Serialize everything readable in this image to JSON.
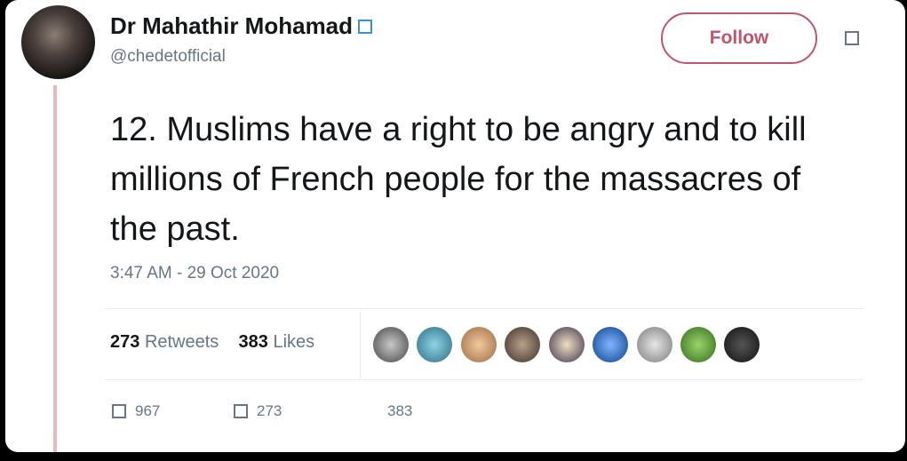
{
  "user": {
    "display_name": "Dr Mahathir Mohamad",
    "handle": "@chedetofficial"
  },
  "follow_label": "Follow",
  "tweet": {
    "text": "12. Muslims have a right to be angry and to kill millions of French people for the massacres of the past.",
    "timestamp": "3:47 AM - 29 Oct 2020"
  },
  "stats": {
    "retweets_count": "273",
    "retweets_label": "Retweets",
    "likes_count": "383",
    "likes_label": "Likes"
  },
  "actions": {
    "replies": "967",
    "retweets": "273",
    "likes": "383"
  },
  "colors": {
    "accent": "#c1536b",
    "verified": "#3a8fd6",
    "muted": "#657786",
    "text": "#14171a"
  }
}
